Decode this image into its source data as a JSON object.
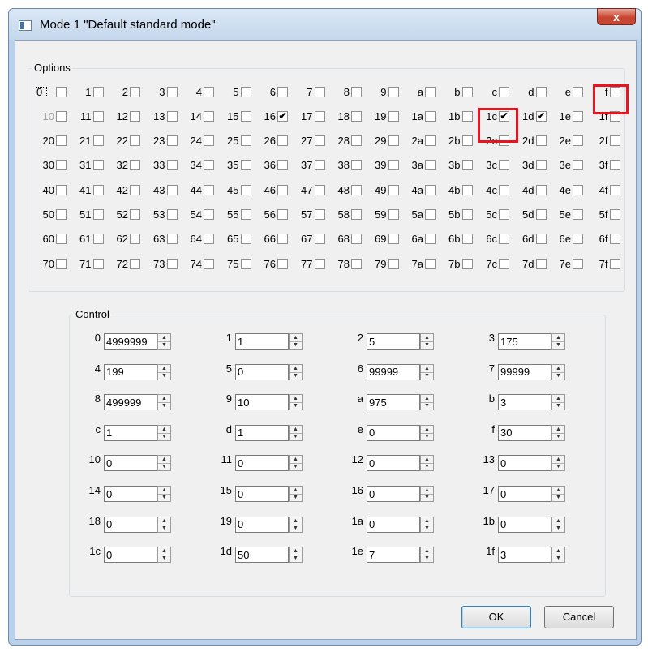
{
  "window": {
    "title": "Mode 1 \"Default standard mode\"",
    "close_glyph": "x"
  },
  "options": {
    "label": "Options",
    "rows": [
      [
        {
          "l": "0",
          "c": false
        },
        {
          "l": "1",
          "c": false
        },
        {
          "l": "2",
          "c": false
        },
        {
          "l": "3",
          "c": false
        },
        {
          "l": "4",
          "c": false
        },
        {
          "l": "5",
          "c": false
        },
        {
          "l": "6",
          "c": false
        },
        {
          "l": "7",
          "c": false
        },
        {
          "l": "8",
          "c": false
        },
        {
          "l": "9",
          "c": false
        },
        {
          "l": "a",
          "c": false
        },
        {
          "l": "b",
          "c": false
        },
        {
          "l": "c",
          "c": false
        },
        {
          "l": "d",
          "c": false
        },
        {
          "l": "e",
          "c": false
        },
        {
          "l": "f",
          "c": false
        }
      ],
      [
        {
          "l": "10",
          "c": false
        },
        {
          "l": "11",
          "c": false
        },
        {
          "l": "12",
          "c": false
        },
        {
          "l": "13",
          "c": false
        },
        {
          "l": "14",
          "c": false
        },
        {
          "l": "15",
          "c": false
        },
        {
          "l": "16",
          "c": true
        },
        {
          "l": "17",
          "c": false
        },
        {
          "l": "18",
          "c": false
        },
        {
          "l": "19",
          "c": false
        },
        {
          "l": "1a",
          "c": false
        },
        {
          "l": "1b",
          "c": false
        },
        {
          "l": "1c",
          "c": true
        },
        {
          "l": "1d",
          "c": true
        },
        {
          "l": "1e",
          "c": false
        },
        {
          "l": "1f",
          "c": false
        }
      ],
      [
        {
          "l": "20",
          "c": false
        },
        {
          "l": "21",
          "c": false
        },
        {
          "l": "22",
          "c": false
        },
        {
          "l": "23",
          "c": false
        },
        {
          "l": "24",
          "c": false
        },
        {
          "l": "25",
          "c": false
        },
        {
          "l": "26",
          "c": false
        },
        {
          "l": "27",
          "c": false
        },
        {
          "l": "28",
          "c": false
        },
        {
          "l": "29",
          "c": false
        },
        {
          "l": "2a",
          "c": false
        },
        {
          "l": "2b",
          "c": false
        },
        {
          "l": "2c",
          "c": false
        },
        {
          "l": "2d",
          "c": false
        },
        {
          "l": "2e",
          "c": false
        },
        {
          "l": "2f",
          "c": false
        }
      ],
      [
        {
          "l": "30",
          "c": false
        },
        {
          "l": "31",
          "c": false
        },
        {
          "l": "32",
          "c": false
        },
        {
          "l": "33",
          "c": false
        },
        {
          "l": "34",
          "c": false
        },
        {
          "l": "35",
          "c": false
        },
        {
          "l": "36",
          "c": false
        },
        {
          "l": "37",
          "c": false
        },
        {
          "l": "38",
          "c": false
        },
        {
          "l": "39",
          "c": false
        },
        {
          "l": "3a",
          "c": false
        },
        {
          "l": "3b",
          "c": false
        },
        {
          "l": "3c",
          "c": false
        },
        {
          "l": "3d",
          "c": false
        },
        {
          "l": "3e",
          "c": false
        },
        {
          "l": "3f",
          "c": false
        }
      ],
      [
        {
          "l": "40",
          "c": false
        },
        {
          "l": "41",
          "c": false
        },
        {
          "l": "42",
          "c": false
        },
        {
          "l": "43",
          "c": false
        },
        {
          "l": "44",
          "c": false
        },
        {
          "l": "45",
          "c": false
        },
        {
          "l": "46",
          "c": false
        },
        {
          "l": "47",
          "c": false
        },
        {
          "l": "48",
          "c": false
        },
        {
          "l": "49",
          "c": false
        },
        {
          "l": "4a",
          "c": false
        },
        {
          "l": "4b",
          "c": false
        },
        {
          "l": "4c",
          "c": false
        },
        {
          "l": "4d",
          "c": false
        },
        {
          "l": "4e",
          "c": false
        },
        {
          "l": "4f",
          "c": false
        }
      ],
      [
        {
          "l": "50",
          "c": false
        },
        {
          "l": "51",
          "c": false
        },
        {
          "l": "52",
          "c": false
        },
        {
          "l": "53",
          "c": false
        },
        {
          "l": "54",
          "c": false
        },
        {
          "l": "55",
          "c": false
        },
        {
          "l": "56",
          "c": false
        },
        {
          "l": "57",
          "c": false
        },
        {
          "l": "58",
          "c": false
        },
        {
          "l": "59",
          "c": false
        },
        {
          "l": "5a",
          "c": false
        },
        {
          "l": "5b",
          "c": false
        },
        {
          "l": "5c",
          "c": false
        },
        {
          "l": "5d",
          "c": false
        },
        {
          "l": "5e",
          "c": false
        },
        {
          "l": "5f",
          "c": false
        }
      ],
      [
        {
          "l": "60",
          "c": false
        },
        {
          "l": "61",
          "c": false
        },
        {
          "l": "62",
          "c": false
        },
        {
          "l": "63",
          "c": false
        },
        {
          "l": "64",
          "c": false
        },
        {
          "l": "65",
          "c": false
        },
        {
          "l": "66",
          "c": false
        },
        {
          "l": "67",
          "c": false
        },
        {
          "l": "68",
          "c": false
        },
        {
          "l": "69",
          "c": false
        },
        {
          "l": "6a",
          "c": false
        },
        {
          "l": "6b",
          "c": false
        },
        {
          "l": "6c",
          "c": false
        },
        {
          "l": "6d",
          "c": false
        },
        {
          "l": "6e",
          "c": false
        },
        {
          "l": "6f",
          "c": false
        }
      ],
      [
        {
          "l": "70",
          "c": false
        },
        {
          "l": "71",
          "c": false
        },
        {
          "l": "72",
          "c": false
        },
        {
          "l": "73",
          "c": false
        },
        {
          "l": "74",
          "c": false
        },
        {
          "l": "75",
          "c": false
        },
        {
          "l": "76",
          "c": false
        },
        {
          "l": "77",
          "c": false
        },
        {
          "l": "78",
          "c": false
        },
        {
          "l": "79",
          "c": false
        },
        {
          "l": "7a",
          "c": false
        },
        {
          "l": "7b",
          "c": false
        },
        {
          "l": "7c",
          "c": false
        },
        {
          "l": "7d",
          "c": false
        },
        {
          "l": "7e",
          "c": false
        },
        {
          "l": "7f",
          "c": false
        }
      ]
    ]
  },
  "control": {
    "label": "Control",
    "fields": [
      {
        "l": "0",
        "v": "4999999"
      },
      {
        "l": "1",
        "v": "1"
      },
      {
        "l": "2",
        "v": "5"
      },
      {
        "l": "3",
        "v": "175"
      },
      {
        "l": "4",
        "v": "199"
      },
      {
        "l": "5",
        "v": "0"
      },
      {
        "l": "6",
        "v": "99999"
      },
      {
        "l": "7",
        "v": "99999"
      },
      {
        "l": "8",
        "v": "499999"
      },
      {
        "l": "9",
        "v": "10"
      },
      {
        "l": "a",
        "v": "975"
      },
      {
        "l": "b",
        "v": "3"
      },
      {
        "l": "c",
        "v": "1"
      },
      {
        "l": "d",
        "v": "1"
      },
      {
        "l": "e",
        "v": "0"
      },
      {
        "l": "f",
        "v": "30"
      },
      {
        "l": "10",
        "v": "0"
      },
      {
        "l": "11",
        "v": "0"
      },
      {
        "l": "12",
        "v": "0"
      },
      {
        "l": "13",
        "v": "0"
      },
      {
        "l": "14",
        "v": "0"
      },
      {
        "l": "15",
        "v": "0"
      },
      {
        "l": "16",
        "v": "0"
      },
      {
        "l": "17",
        "v": "0"
      },
      {
        "l": "18",
        "v": "0"
      },
      {
        "l": "19",
        "v": "0"
      },
      {
        "l": "1a",
        "v": "0"
      },
      {
        "l": "1b",
        "v": "0"
      },
      {
        "l": "1c",
        "v": "0"
      },
      {
        "l": "1d",
        "v": "50"
      },
      {
        "l": "1e",
        "v": "7"
      },
      {
        "l": "1f",
        "v": "3"
      }
    ]
  },
  "buttons": {
    "ok": "OK",
    "cancel": "Cancel"
  },
  "colors": {
    "highlight": "#e8141f",
    "titlebar": "#c4d7ec",
    "client": "#f0f0f0",
    "close": "#c8442f"
  }
}
